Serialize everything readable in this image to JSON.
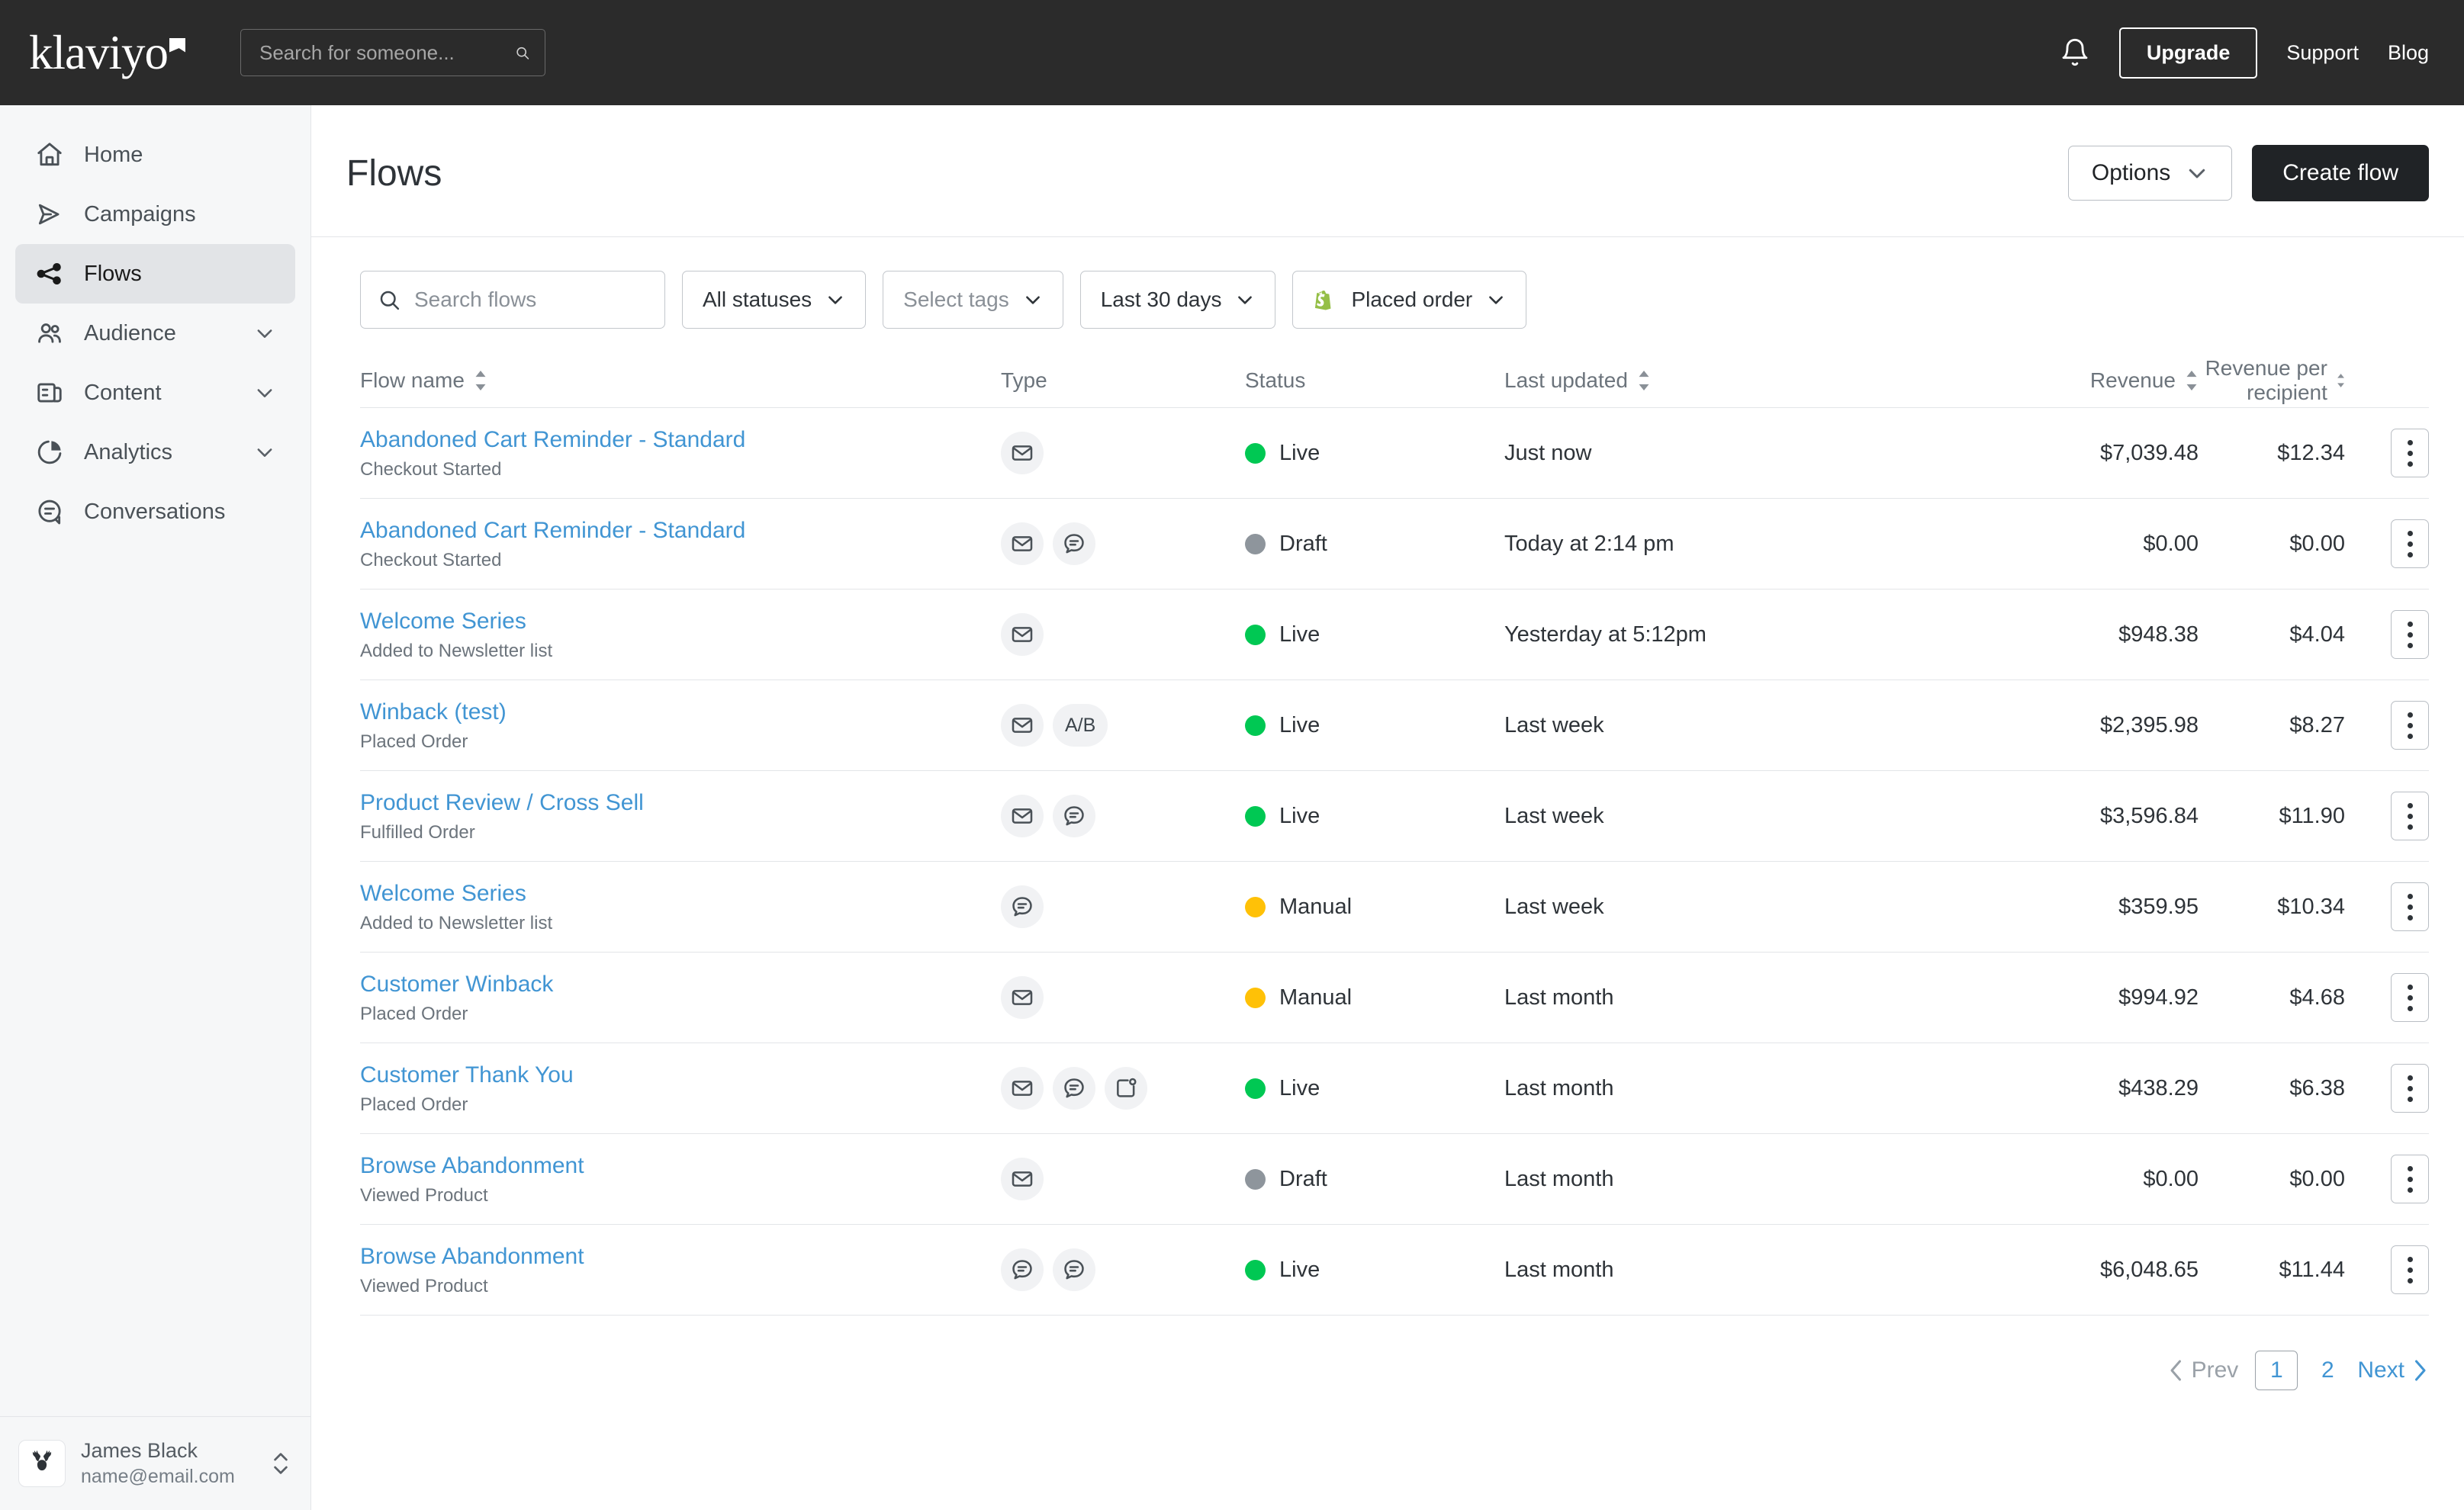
{
  "topbar": {
    "logo_text": "klaviyo",
    "search_placeholder": "Search for someone...",
    "search_value": "",
    "notifications_icon": "bell-icon",
    "upgrade_label": "Upgrade",
    "support_label": "Support",
    "blog_label": "Blog"
  },
  "sidebar": {
    "items": [
      {
        "label": "Home",
        "icon": "home-icon",
        "active": false,
        "expandable": false
      },
      {
        "label": "Campaigns",
        "icon": "send-icon",
        "active": false,
        "expandable": false
      },
      {
        "label": "Flows",
        "icon": "flows-icon",
        "active": true,
        "expandable": false
      },
      {
        "label": "Audience",
        "icon": "people-icon",
        "active": false,
        "expandable": true
      },
      {
        "label": "Content",
        "icon": "content-icon",
        "active": false,
        "expandable": true
      },
      {
        "label": "Analytics",
        "icon": "pie-chart-icon",
        "active": false,
        "expandable": true
      },
      {
        "label": "Conversations",
        "icon": "conversations-icon",
        "active": false,
        "expandable": false
      }
    ],
    "profile": {
      "avatar_icon": "deer-avatar-icon",
      "name": "James Black",
      "email": "name@email.com",
      "switcher_icon": "chevron-up-down-icon"
    }
  },
  "page": {
    "title": "Flows",
    "options_label": "Options",
    "create_label": "Create flow"
  },
  "filters": {
    "search_placeholder": "Search flows",
    "search_value": "",
    "status_label": "All statuses",
    "tags_label": "Select tags",
    "date_label": "Last 30 days",
    "metric_label": "Placed order",
    "metric_icon": "shopify-icon",
    "shopify_green": "#95BF47"
  },
  "table": {
    "columns": [
      {
        "label": "Flow name",
        "sortable": true
      },
      {
        "label": "Type",
        "sortable": false
      },
      {
        "label": "Status",
        "sortable": false
      },
      {
        "label": "Last updated",
        "sortable": true
      },
      {
        "label": "Revenue",
        "sortable": true
      },
      {
        "label": "Revenue per recipient",
        "sortable": true
      }
    ],
    "status_colors": {
      "Live": "#00C853",
      "Draft": "#8E959C",
      "Manual": "#FFC107"
    },
    "rows": [
      {
        "name": "Abandoned Cart Reminder - Standard",
        "trigger": "Checkout Started",
        "types": [
          "email"
        ],
        "status": "Live",
        "updated": "Just now",
        "revenue": "$7,039.48",
        "rpr": "$12.34"
      },
      {
        "name": "Abandoned Cart Reminder - Standard",
        "trigger": "Checkout Started",
        "types": [
          "email",
          "sms"
        ],
        "status": "Draft",
        "updated": "Today at 2:14 pm",
        "revenue": "$0.00",
        "rpr": "$0.00"
      },
      {
        "name": "Welcome Series",
        "trigger": "Added to Newsletter list",
        "types": [
          "email"
        ],
        "status": "Live",
        "updated": "Yesterday at 5:12pm",
        "revenue": "$948.38",
        "rpr": "$4.04"
      },
      {
        "name": "Winback (test)",
        "trigger": "Placed Order",
        "types": [
          "email",
          "ab"
        ],
        "status": "Live",
        "updated": "Last week",
        "revenue": "$2,395.98",
        "rpr": "$8.27"
      },
      {
        "name": "Product Review / Cross Sell",
        "trigger": "Fulfilled Order",
        "types": [
          "email",
          "sms"
        ],
        "status": "Live",
        "updated": "Last week",
        "revenue": "$3,596.84",
        "rpr": "$11.90"
      },
      {
        "name": "Welcome Series",
        "trigger": "Added to Newsletter list",
        "types": [
          "sms"
        ],
        "status": "Manual",
        "updated": "Last week",
        "revenue": "$359.95",
        "rpr": "$10.34"
      },
      {
        "name": "Customer Winback",
        "trigger": "Placed Order",
        "types": [
          "email"
        ],
        "status": "Manual",
        "updated": "Last month",
        "revenue": "$994.92",
        "rpr": "$4.68"
      },
      {
        "name": "Customer Thank You",
        "trigger": "Placed Order",
        "types": [
          "email",
          "sms",
          "push"
        ],
        "status": "Live",
        "updated": "Last month",
        "revenue": "$438.29",
        "rpr": "$6.38"
      },
      {
        "name": "Browse Abandonment",
        "trigger": "Viewed Product",
        "types": [
          "email"
        ],
        "status": "Draft",
        "updated": "Last month",
        "revenue": "$0.00",
        "rpr": "$0.00"
      },
      {
        "name": "Browse Abandonment",
        "trigger": "Viewed Product",
        "types": [
          "sms",
          "sms"
        ],
        "status": "Live",
        "updated": "Last month",
        "revenue": "$6,048.65",
        "rpr": "$11.44"
      }
    ]
  },
  "pagination": {
    "prev_label": "Prev",
    "next_label": "Next",
    "pages": [
      "1",
      "2"
    ],
    "current_page": "1"
  }
}
